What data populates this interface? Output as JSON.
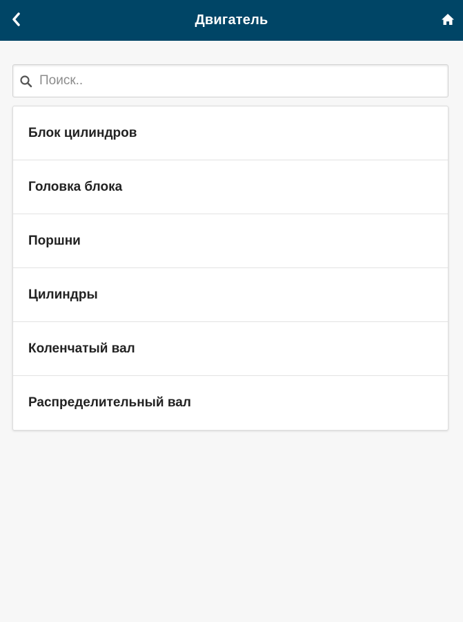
{
  "header": {
    "title": "Двигатель",
    "back_icon": "chevron-left-icon",
    "home_icon": "home-icon"
  },
  "search": {
    "placeholder": "Поиск..",
    "value": "",
    "icon": "search-icon"
  },
  "list": {
    "items": [
      {
        "label": "Блок цилиндров"
      },
      {
        "label": "Головка блока"
      },
      {
        "label": "Поршни"
      },
      {
        "label": "Цилиндры"
      },
      {
        "label": "Коленчатый вал"
      },
      {
        "label": "Распределительный вал"
      }
    ]
  },
  "colors": {
    "header_bg": "#004566",
    "page_bg": "#f7f7f7",
    "text": "#222222"
  }
}
